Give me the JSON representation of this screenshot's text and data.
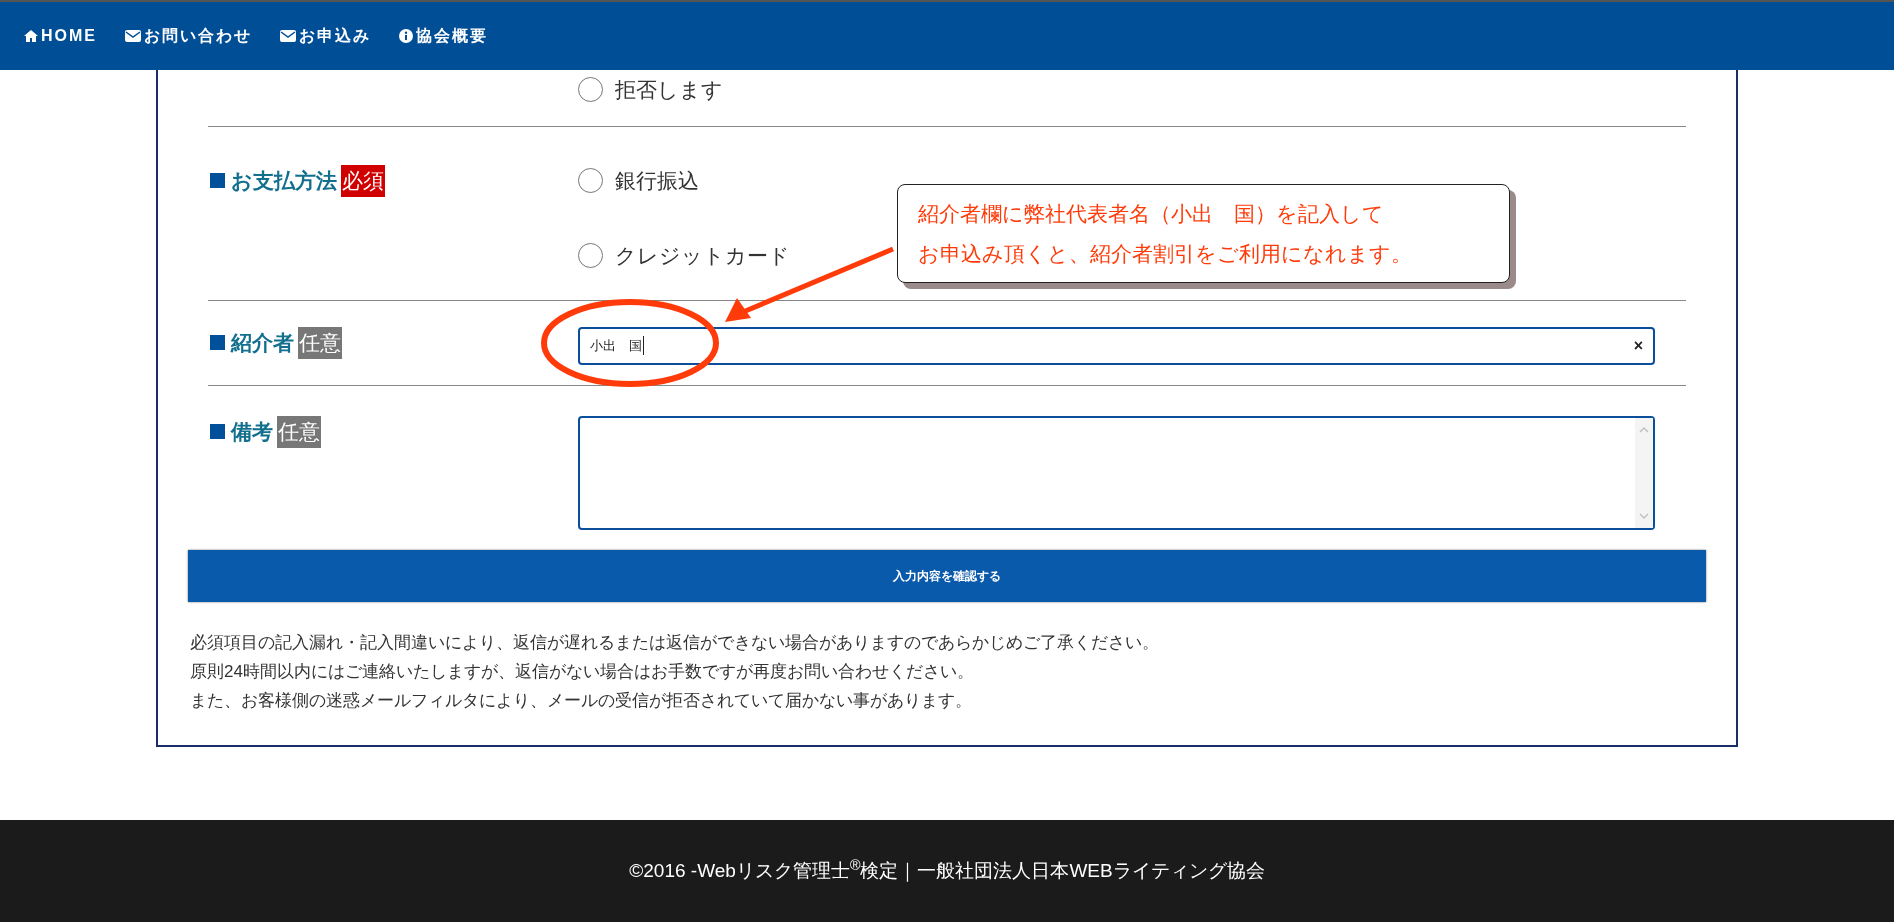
{
  "nav": [
    {
      "kind": "home",
      "label": "HOME"
    },
    {
      "kind": "mail",
      "label": "お問い合わせ"
    },
    {
      "kind": "mail",
      "label": "お申込み"
    },
    {
      "kind": "info",
      "label": "協会概要"
    }
  ],
  "form": {
    "rows": [
      {
        "kind": "radio",
        "options": [
          {
            "label": "拒否します",
            "selected": false
          }
        ]
      },
      {
        "kind": "radio",
        "label": "お支払方法",
        "badge": {
          "text": "必須",
          "required": true
        },
        "options": [
          {
            "label": "銀行振込",
            "selected": false
          },
          {
            "label": "クレジットカード",
            "selected": false
          }
        ]
      },
      {
        "kind": "text",
        "label": "紹介者",
        "badge": {
          "text": "任意",
          "required": false
        },
        "value": "小出　国",
        "clear": "×"
      },
      {
        "kind": "textarea",
        "label": "備考",
        "badge": {
          "text": "任意",
          "required": false
        }
      }
    ],
    "submit": "入力内容を確認する",
    "notes": [
      "必須項目の記入漏れ・記入間違いにより、返信が遅れるまたは返信ができない場合がありますのであらかじめご了承ください。",
      "原則24時間以内にはご連絡いたしますが、返信がない場合はお手数ですが再度お問い合わせください。",
      "また、お客様側の迷惑メールフィルタにより、メールの受信が拒否されていて届かない事があります。"
    ]
  },
  "callout": {
    "lines": [
      "紹介者欄に弊社代表者名（小出　国）を記入して",
      "お申込み頂くと、紹介者割引をご利用になれます。"
    ]
  },
  "footer": "©2016 -Webリスク管理士$^{®}$検定｜一般社団法人日本WEBライティング協会"
}
